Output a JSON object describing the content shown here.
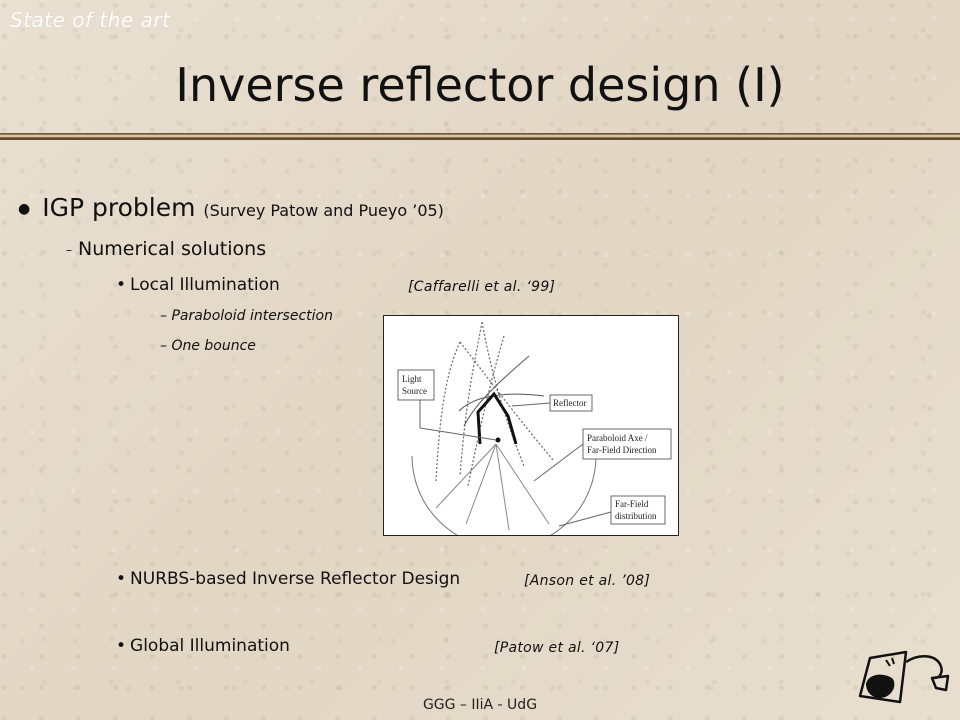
{
  "header": {
    "section": "State of the art",
    "title": "Inverse reflector design (I)"
  },
  "content": {
    "main_bullet": {
      "text": "IGP problem",
      "reference": "(Survey Patow and Pueyo ’05)"
    },
    "sub_bullet": "Numerical solutions",
    "items": [
      {
        "label": "Local Illumination",
        "citation": "[Caffarelli et al. ‘99]",
        "details": [
          "– Paraboloid intersection",
          "– One bounce"
        ]
      },
      {
        "label": "NURBS-based Inverse Reflector Design",
        "citation": "[Anson et al. ’08]"
      },
      {
        "label": "Global Illumination",
        "citation": "[Patow et al. ‘07]"
      }
    ]
  },
  "figure": {
    "labels": {
      "light_source": [
        "Light",
        "Source"
      ],
      "reflector": "Reflector",
      "paraboloid": [
        "Paraboloid Axe /",
        "Far-Field Direction"
      ],
      "far_field": [
        "Far-Field",
        "distribution"
      ]
    }
  },
  "footer": {
    "text": "GGG – IIiA - UdG"
  },
  "logo": {
    "icon": "dragon-sketch-icon"
  }
}
